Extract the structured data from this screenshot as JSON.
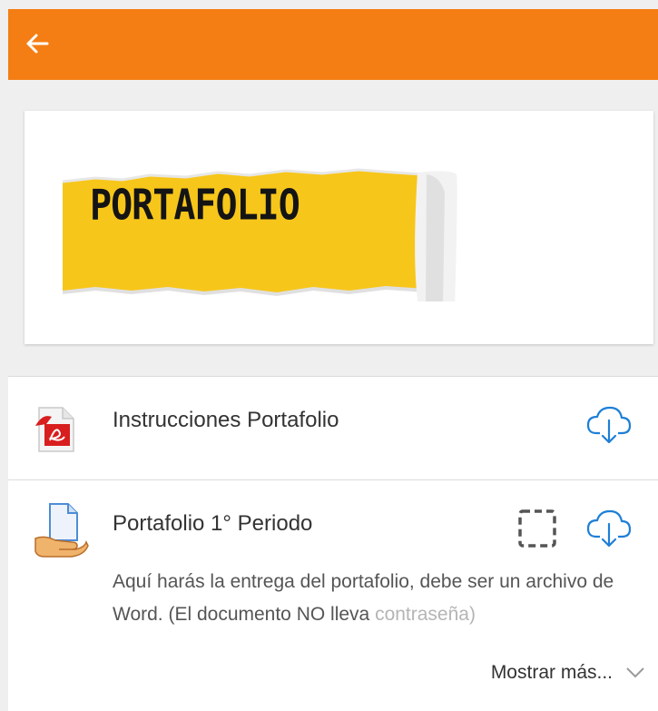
{
  "header": {
    "back_icon": "arrow-left-icon",
    "color": "#f47e14"
  },
  "banner": {
    "text": "PORTAFOLIO",
    "paper_color": "#f7c61a"
  },
  "items": [
    {
      "title": "Instrucciones Portafolio",
      "icon": "pdf-file-icon",
      "action_icon": "cloud-download-icon"
    },
    {
      "title": "Portafolio 1° Periodo",
      "icon": "assignment-hand-icon",
      "status_icon": "dashed-square-icon",
      "action_icon": "cloud-download-icon",
      "description_visible": "Aquí harás la entrega del portafolio, debe ser un archivo de Word. (El documento NO lleva ",
      "description_faded": "contraseña)",
      "more_label": "Mostrar más...",
      "more_icon": "chevron-down-icon"
    }
  ],
  "colors": {
    "accent_blue": "#1e7fd6",
    "text": "#333333"
  }
}
